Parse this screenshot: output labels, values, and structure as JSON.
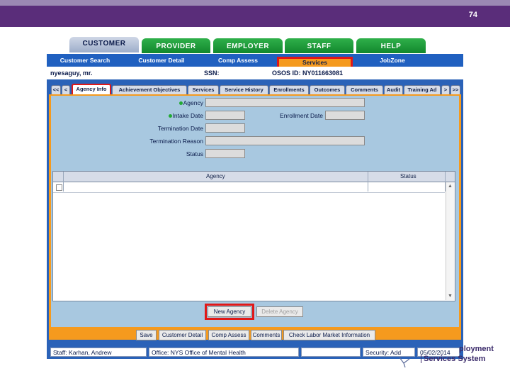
{
  "slide_number": "74",
  "main_tabs": [
    {
      "label": "CUSTOMER",
      "active": true
    },
    {
      "label": "PROVIDER",
      "active": false
    },
    {
      "label": "EMPLOYER",
      "active": false
    },
    {
      "label": "STAFF",
      "active": false
    },
    {
      "label": "HELP",
      "active": false
    }
  ],
  "sub_nav": [
    {
      "label": "Customer Search"
    },
    {
      "label": "Customer Detail"
    },
    {
      "label": "Comp Assess"
    },
    {
      "label": "Services",
      "selected": true
    },
    {
      "label": "JobZone"
    }
  ],
  "customer": {
    "name": "nyesaguy, mr.",
    "ssn": "SSN:",
    "osos_id": "OSOS ID: NY011663081"
  },
  "sub_tabs": {
    "nav_first": "<<",
    "nav_prev": "<",
    "items": [
      {
        "label": "Agency Info",
        "active": true
      },
      {
        "label": "Achievement Objectives"
      },
      {
        "label": "Services"
      },
      {
        "label": "Service History"
      },
      {
        "label": "Enrollments"
      },
      {
        "label": "Outcomes"
      },
      {
        "label": "Comments"
      },
      {
        "label": "Audit"
      },
      {
        "label": "Training Ad"
      }
    ],
    "nav_next": ">",
    "nav_last": ">>"
  },
  "form": {
    "agency_label": "Agency",
    "intake_date_label": "Intake Date",
    "enrollment_date_label": "Enrollment Date",
    "termination_date_label": "Termination Date",
    "termination_reason_label": "Termination Reason",
    "status_label": "Status"
  },
  "grid": {
    "col_agency": "Agency",
    "col_status": "Status"
  },
  "buttons": {
    "new_agency": "New Agency",
    "delete_agency": "Delete Agency"
  },
  "bottom_buttons": [
    "Save",
    "Customer Detail",
    "Comp Assess",
    "Comments",
    "Check Labor Market Information"
  ],
  "status_bar": {
    "staff": "Staff: Karhan, Andrew",
    "office": "Office: NYS Office of Mental Health",
    "empty": "",
    "security": "Security: Add",
    "date": "05/02/2014"
  },
  "logo": {
    "line1": "ployment",
    "line2": "Services System"
  },
  "colors": {
    "header_purple": "#5a2d7a",
    "tab_green": "#12872d",
    "app_blue": "#2a62b8",
    "panel_orange": "#f59a1e",
    "highlight_red": "#e01818"
  }
}
